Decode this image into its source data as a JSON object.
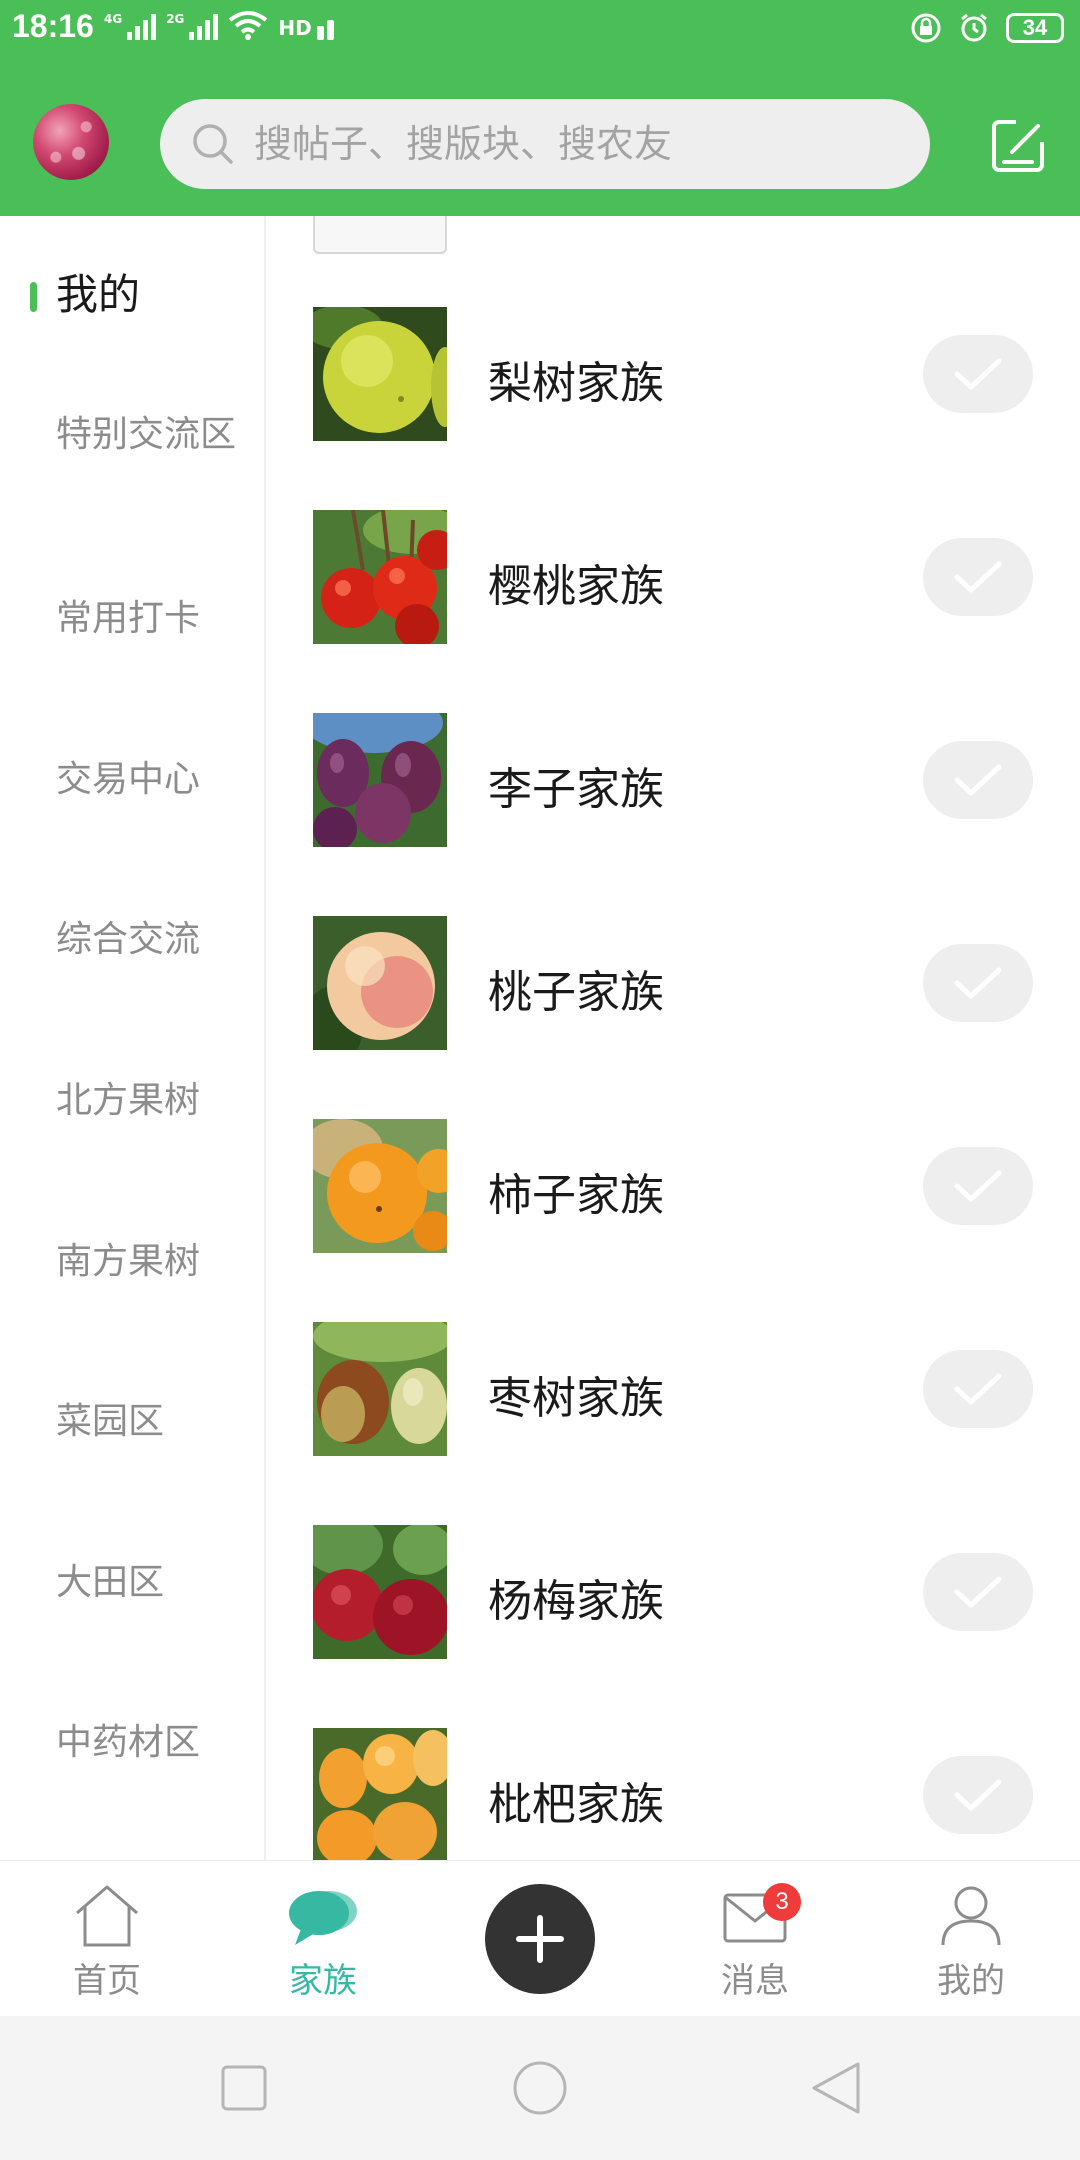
{
  "status": {
    "time": "18:16",
    "signal1_label": "4G",
    "signal2_label": "2G",
    "hd_label": "HD",
    "battery": "34"
  },
  "search": {
    "placeholder": "搜帖子、搜版块、搜农友"
  },
  "sidebar": {
    "items": [
      {
        "label": "我的"
      },
      {
        "label": "特别交流区"
      },
      {
        "label": "常用打卡"
      },
      {
        "label": "交易中心"
      },
      {
        "label": "综合交流"
      },
      {
        "label": "北方果树"
      },
      {
        "label": "南方果树"
      },
      {
        "label": "菜园区"
      },
      {
        "label": "大田区"
      },
      {
        "label": "中药材区"
      }
    ],
    "active_index": 0
  },
  "families": [
    {
      "name": "梨树家族",
      "thumb": "pear",
      "joined": true
    },
    {
      "name": "樱桃家族",
      "thumb": "cherry",
      "joined": true
    },
    {
      "name": "李子家族",
      "thumb": "plum",
      "joined": true
    },
    {
      "name": "桃子家族",
      "thumb": "peach",
      "joined": true
    },
    {
      "name": "柿子家族",
      "thumb": "persimmon",
      "joined": true
    },
    {
      "name": "枣树家族",
      "thumb": "jujube",
      "joined": true
    },
    {
      "name": "杨梅家族",
      "thumb": "bayberry",
      "joined": true
    },
    {
      "name": "枇杷家族",
      "thumb": "loquat",
      "joined": true
    }
  ],
  "bottom_nav": {
    "home": "首页",
    "family": "家族",
    "messages": "消息",
    "messages_badge": "3",
    "me": "我的"
  },
  "colors": {
    "brand_green": "#4bbf57",
    "active_teal": "#36b8a3",
    "badge_red": "#f03b3b"
  }
}
